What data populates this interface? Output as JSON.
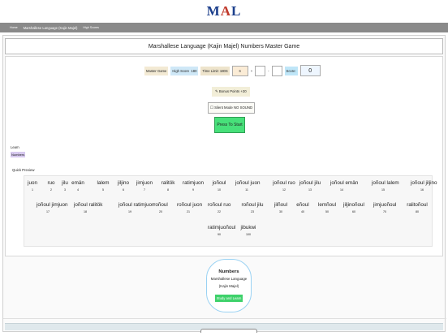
{
  "logo": {
    "text_m": "M",
    "text_a": "A",
    "text_l": "L"
  },
  "nav": {
    "home": "Home",
    "item": "Marshallese Language (Kajin Majel)",
    "menu": "High Scores"
  },
  "title": "Marshallese Language (Kajin Majel) Numbers Master Game",
  "controls": {
    "master_label": "Master Game",
    "high_score_label": "High Score",
    "high_score_value": "180",
    "time_limit_label": "Time Limit: 180S",
    "time_value": "6",
    "op_plus": "+",
    "op_minus": "-",
    "score_label": "Score:",
    "score_value": "0"
  },
  "bonus": "Bonus Points +20",
  "silent": "Silent Mode NO SOUND",
  "start_button": "Press To Start",
  "learn_label": "Learn",
  "learn_tag": "Numbers",
  "quick_preview": "Quick Preview",
  "preview": [
    {
      "word": "juon",
      "num": "1"
    },
    {
      "word": "ruo",
      "num": "2"
    },
    {
      "word": "jilu",
      "num": "3"
    },
    {
      "word": "emän",
      "num": "4"
    },
    {
      "word": "lalem",
      "num": "5"
    },
    {
      "word": "jiljino",
      "num": "6"
    },
    {
      "word": "jimjuon",
      "num": "7"
    },
    {
      "word": "ralitök",
      "num": "8"
    },
    {
      "word": "ratimjuon",
      "num": "9"
    },
    {
      "word": "joñoul",
      "num": "10"
    },
    {
      "word": "joñoul juon",
      "num": "11"
    },
    {
      "word": "joñoul ruo",
      "num": "12"
    },
    {
      "word": "joñoul jilu",
      "num": "13"
    },
    {
      "word": "joñoul emän",
      "num": "14"
    },
    {
      "word": "joñoul lalem",
      "num": "15"
    },
    {
      "word": "joñoul jiljino",
      "num": "16"
    },
    {
      "word": "joñoul jimjuon",
      "num": "17"
    },
    {
      "word": "joñoul ralitök",
      "num": "18"
    },
    {
      "word": "joñoul ratimjuon",
      "num": "19"
    },
    {
      "word": "roñoul",
      "num": "20"
    },
    {
      "word": "roñoul juon",
      "num": "21"
    },
    {
      "word": "roñoul ruo",
      "num": "22"
    },
    {
      "word": "roñoul jilu",
      "num": "23"
    },
    {
      "word": "jilñoul",
      "num": "30"
    },
    {
      "word": "eñoul",
      "num": "40"
    },
    {
      "word": "lemñoul",
      "num": "50"
    },
    {
      "word": "jiljinoñoul",
      "num": "60"
    },
    {
      "word": "jimjuoñoul",
      "num": "70"
    },
    {
      "word": "ralitoñoul",
      "num": "80"
    },
    {
      "word": "ratimjuoñoul",
      "num": "90"
    },
    {
      "word": "jibukwi",
      "num": "100"
    }
  ],
  "card": {
    "title": "Numbers",
    "line1": "Marshallese Language",
    "line2": "(Kajin Majel)",
    "button": "Study and Learn"
  }
}
